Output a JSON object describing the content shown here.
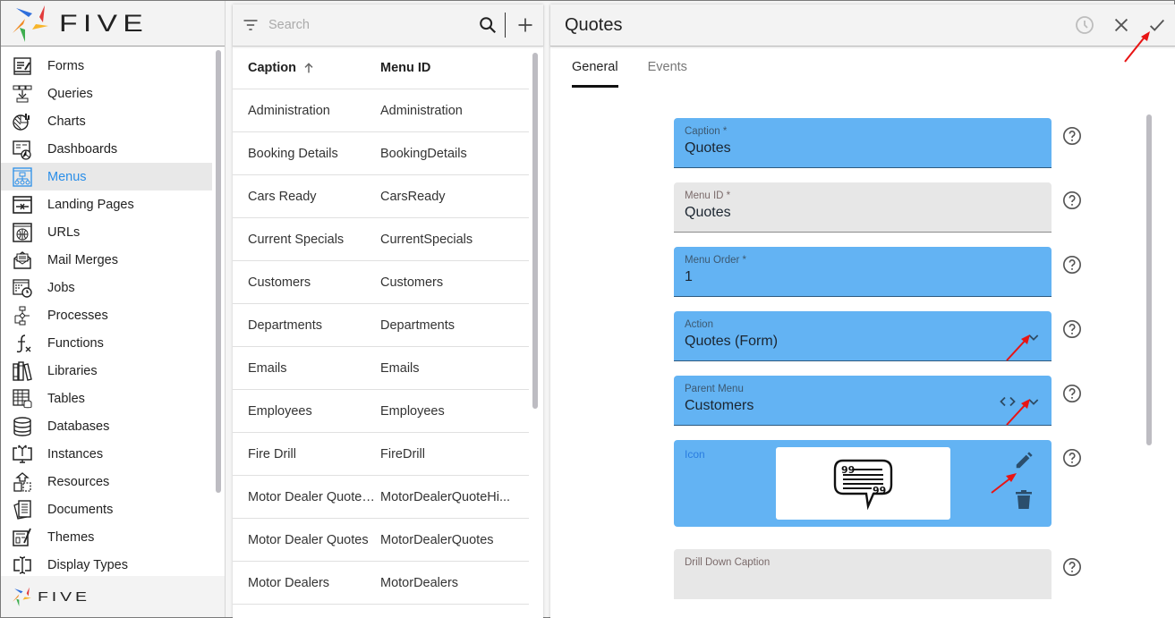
{
  "app": {
    "brand": "FIVE",
    "footer_brand": "FIVE"
  },
  "sidebar": {
    "items": [
      {
        "label": "Forms",
        "icon": "forms-icon",
        "active": false
      },
      {
        "label": "Queries",
        "icon": "queries-icon",
        "active": false
      },
      {
        "label": "Charts",
        "icon": "charts-icon",
        "active": false
      },
      {
        "label": "Dashboards",
        "icon": "dashboards-icon",
        "active": false
      },
      {
        "label": "Menus",
        "icon": "menus-icon",
        "active": true
      },
      {
        "label": "Landing Pages",
        "icon": "landing-pages-icon",
        "active": false
      },
      {
        "label": "URLs",
        "icon": "urls-icon",
        "active": false
      },
      {
        "label": "Mail Merges",
        "icon": "mail-merges-icon",
        "active": false
      },
      {
        "label": "Jobs",
        "icon": "jobs-icon",
        "active": false
      },
      {
        "label": "Processes",
        "icon": "processes-icon",
        "active": false
      },
      {
        "label": "Functions",
        "icon": "functions-icon",
        "active": false
      },
      {
        "label": "Libraries",
        "icon": "libraries-icon",
        "active": false
      },
      {
        "label": "Tables",
        "icon": "tables-icon",
        "active": false
      },
      {
        "label": "Databases",
        "icon": "databases-icon",
        "active": false
      },
      {
        "label": "Instances",
        "icon": "instances-icon",
        "active": false
      },
      {
        "label": "Resources",
        "icon": "resources-icon",
        "active": false
      },
      {
        "label": "Documents",
        "icon": "documents-icon",
        "active": false
      },
      {
        "label": "Themes",
        "icon": "themes-icon",
        "active": false
      },
      {
        "label": "Display Types",
        "icon": "display-types-icon",
        "active": false
      }
    ]
  },
  "list": {
    "search_placeholder": "Search",
    "search_value": "",
    "columns": {
      "caption": "Caption",
      "menu_id": "Menu ID"
    },
    "sort": {
      "column": "caption",
      "direction": "ascending"
    },
    "rows": [
      {
        "caption": "Administration",
        "menu_id": "Administration"
      },
      {
        "caption": "Booking Details",
        "menu_id": "BookingDetails"
      },
      {
        "caption": "Cars Ready",
        "menu_id": "CarsReady"
      },
      {
        "caption": "Current Specials",
        "menu_id": "CurrentSpecials"
      },
      {
        "caption": "Customers",
        "menu_id": "Customers"
      },
      {
        "caption": "Departments",
        "menu_id": "Departments"
      },
      {
        "caption": "Emails",
        "menu_id": "Emails"
      },
      {
        "caption": "Employees",
        "menu_id": "Employees"
      },
      {
        "caption": "Fire Drill",
        "menu_id": "FireDrill"
      },
      {
        "caption": "Motor Dealer Quote ...",
        "menu_id": "MotorDealerQuoteHi..."
      },
      {
        "caption": "Motor Dealer Quotes",
        "menu_id": "MotorDealerQuotes"
      },
      {
        "caption": "Motor Dealers",
        "menu_id": "MotorDealers"
      }
    ]
  },
  "detail": {
    "title": "Quotes",
    "tabs": [
      {
        "label": "General",
        "active": true
      },
      {
        "label": "Events",
        "active": false
      }
    ],
    "fields": {
      "caption": {
        "label": "Caption *",
        "value": "Quotes"
      },
      "menu_id": {
        "label": "Menu ID *",
        "value": "Quotes"
      },
      "menu_order": {
        "label": "Menu Order *",
        "value": "1"
      },
      "action": {
        "label": "Action",
        "value": "Quotes (Form)"
      },
      "parent_menu": {
        "label": "Parent Menu",
        "value": "Customers"
      },
      "icon": {
        "label": "Icon",
        "preview": "quote-speech-bubble-icon"
      },
      "drill_down_caption": {
        "label": "Drill Down Caption",
        "value": ""
      }
    }
  },
  "colors": {
    "accent": "#2a8ee8",
    "field_active": "#63b3f3",
    "field_readonly": "#e7e7e7",
    "annotation_arrow": "#e81414"
  }
}
